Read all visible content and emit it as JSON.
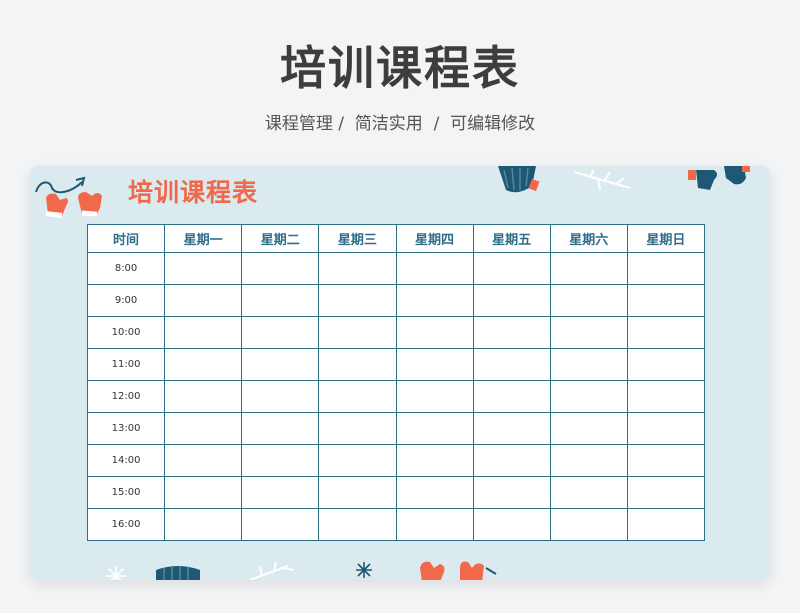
{
  "header": {
    "title": "培训课程表",
    "subtitle": "课程管理 /  简洁实用  /  可编辑修改"
  },
  "card": {
    "title": "培训课程表"
  },
  "schedule": {
    "headers": [
      "时间",
      "星期一",
      "星期二",
      "星期三",
      "星期四",
      "星期五",
      "星期六",
      "星期日"
    ],
    "times": [
      "8:00",
      "9:00",
      "10:00",
      "11:00",
      "12:00",
      "13:00",
      "14:00",
      "15:00",
      "16:00"
    ]
  },
  "colors": {
    "accent": "#f0694a",
    "table_line": "#2f6f86",
    "card_bg": "#dbeaef",
    "deco_navy": "#1f5872"
  },
  "icons": [
    "mitten-icon",
    "scarf-icon",
    "snowflake-icon",
    "twig-icon"
  ]
}
